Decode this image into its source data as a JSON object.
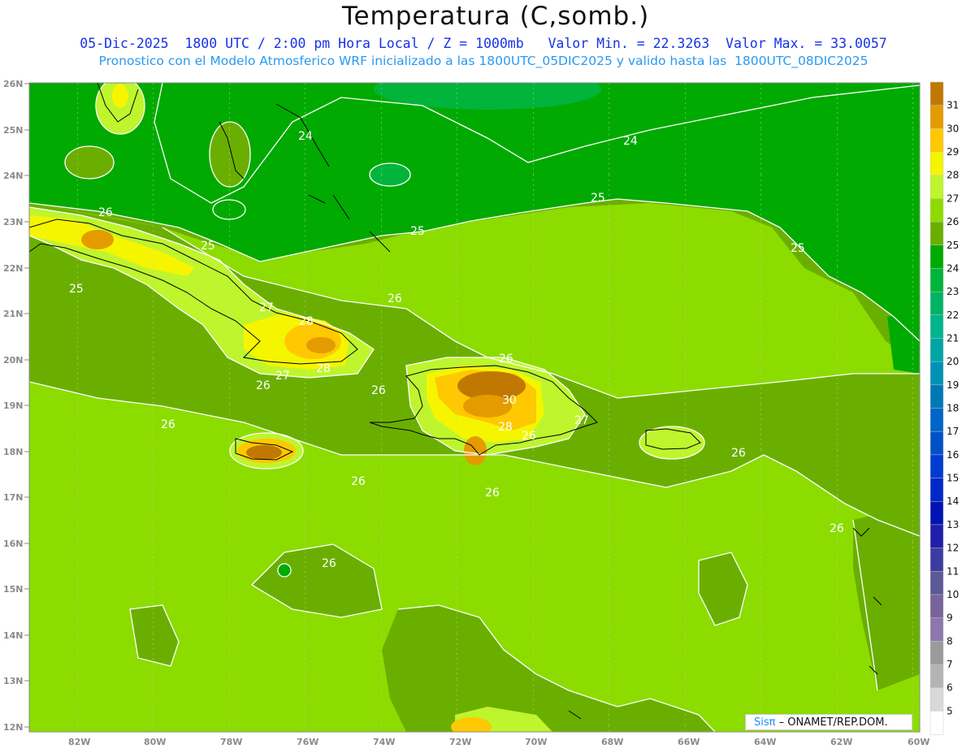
{
  "title": "Temperatura (C,somb.)",
  "subtitle_line1": "05-Dic-2025  1800 UTC / 2:00 pm Hora Local / Z = 1000mb   Valor Min. = 22.3263  Valor Max. = 33.0057",
  "subtitle_line2": "Pronostico con el Modelo Atmosferico WRF inicializado a las 1800UTC_05DIC2025 y valido hasta las  1800UTC_08DIC2025",
  "lat_labels": [
    "26N",
    "25N",
    "24N",
    "23N",
    "22N",
    "21N",
    "20N",
    "19N",
    "18N",
    "17N",
    "16N",
    "15N",
    "14N",
    "13N",
    "12N"
  ],
  "lon_labels": [
    "82W",
    "80W",
    "78W",
    "76W",
    "74W",
    "72W",
    "70W",
    "68W",
    "66W",
    "64W",
    "62W",
    "60W"
  ],
  "colorbar": {
    "levels": [
      "31",
      "30",
      "29",
      "28",
      "27",
      "26",
      "25",
      "24",
      "23",
      "22",
      "21",
      "20",
      "19",
      "18",
      "17",
      "16",
      "15",
      "14",
      "13",
      "12",
      "11",
      "10",
      "9",
      "8",
      "7",
      "6",
      "5"
    ],
    "colors": [
      "#c07800",
      "#e39b00",
      "#ffc800",
      "#f5f500",
      "#bef52d",
      "#8cdc00",
      "#6aaf00",
      "#00aa00",
      "#00b43c",
      "#00b464",
      "#00b48c",
      "#00a5a5",
      "#0091b4",
      "#0078b4",
      "#0064c8",
      "#0050c8",
      "#003cd2",
      "#0028c8",
      "#0014b4",
      "#1e1eaa",
      "#3c3ca0",
      "#5a5a96",
      "#78649a",
      "#8c78aa",
      "#9a9a9a",
      "#b4b4b4",
      "#d8d8d8",
      "#ffffff"
    ]
  },
  "contour_labels": [
    "24",
    "24",
    "25",
    "25",
    "25",
    "25",
    "26",
    "25",
    "26",
    "27",
    "27",
    "28",
    "26",
    "26",
    "26",
    "26",
    "26",
    "26",
    "27",
    "28",
    "30",
    "28",
    "26",
    "26",
    "26",
    "26"
  ],
  "credit": {
    "sis": "Sisπ",
    "org": "– ONAMET/REP.DOM."
  }
}
